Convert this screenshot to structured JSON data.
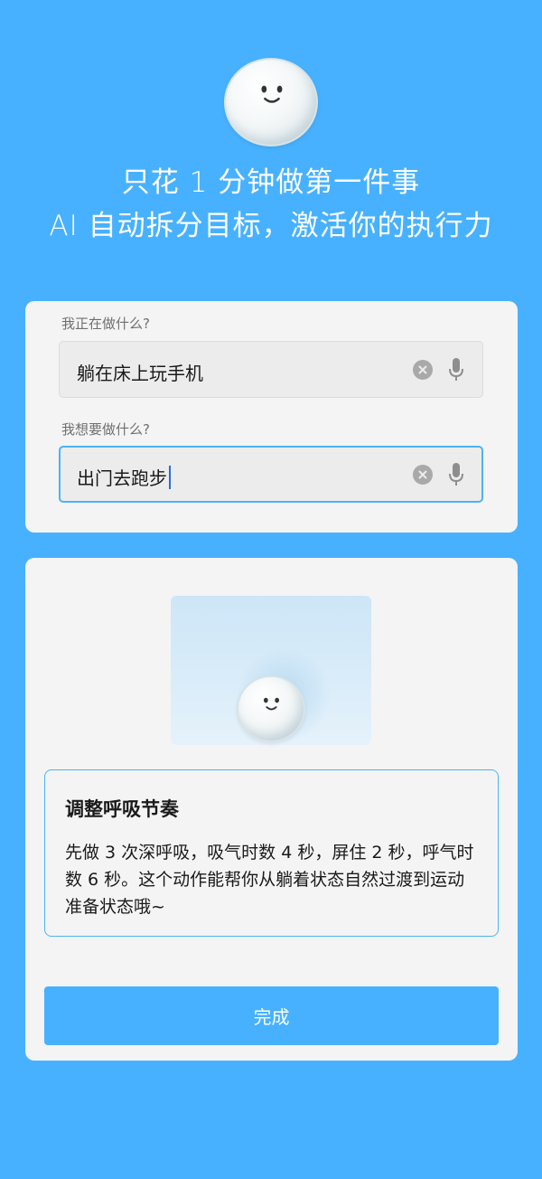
{
  "hero": {
    "mascot_icon": "snowball-mascot-icon",
    "line1": "只花 1 分钟做第一件事",
    "line2": "AI 自动拆分目标，激活你的执行力"
  },
  "form": {
    "current_label": "我正在做什么?",
    "current_value": "躺在床上玩手机",
    "goal_label": "我想要做什么?",
    "goal_value": "出门去跑步",
    "clear_icon": "clear-icon",
    "mic_icon": "microphone-icon"
  },
  "result": {
    "illustration_icon": "snowball-mascot-icon",
    "tip_title": "调整呼吸节奏",
    "tip_body": "先做 3 次深呼吸，吸气时数 4 秒，屏住 2 秒，呼气时数 6 秒。这个动作能帮你从躺着状态自然过渡到运动准备状态哦~",
    "done_label": "完成"
  },
  "colors": {
    "background": "#47b1ff",
    "accent": "#4bb3f5",
    "card": "#f4f4f4"
  }
}
